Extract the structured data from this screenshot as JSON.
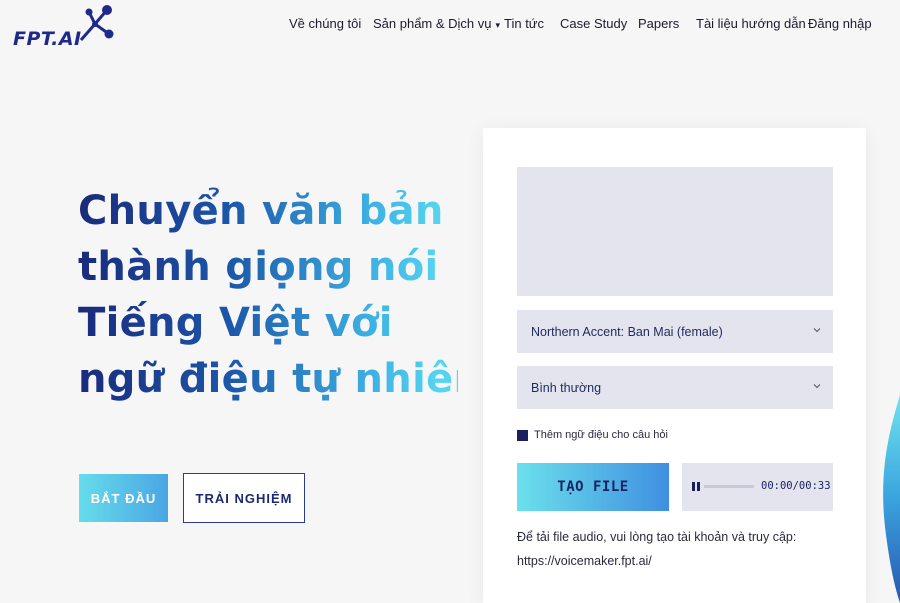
{
  "header": {
    "logo_text": "FPT.AI",
    "nav": [
      {
        "label": "Về chúng tôi"
      },
      {
        "label": "Sản phẩm & Dịch vụ",
        "has_dropdown": true
      },
      {
        "label": "Tin tức"
      },
      {
        "label": "Case Study"
      },
      {
        "label": "Papers"
      },
      {
        "label": "Tài liệu hướng dẫn"
      },
      {
        "label": "Đăng nhập"
      }
    ]
  },
  "hero": {
    "title_lines": [
      "Chuyển văn bản",
      "thành giọng nói",
      "Tiếng Việt với",
      "ngữ điệu tự nhiên"
    ],
    "start_button": "BẮT ĐẦU",
    "try_button": "TRẢI NGHIỆM"
  },
  "tts_card": {
    "text_input_value": "",
    "voice_selected": "Northern Accent: Ban Mai (female)",
    "speed_selected": "Bình thường",
    "question_intonation_label": "Thêm ngữ điệu cho câu hỏi",
    "create_button": "TẠO FILE",
    "player": {
      "time": "00:00/00:33",
      "progress": 0.0
    },
    "note_text": "Để tải file audio, vui lòng tạo tài khoản và truy cập:",
    "note_url": "https://voicemaker.fpt.ai/"
  },
  "colors": {
    "brand_dark": "#1a2a7c",
    "brand_light": "#56d4ef",
    "field_bg": "#e4e4ef"
  },
  "icons": {
    "logo": "fpt-ai-logo",
    "select_arrow": "chevron-down-icon",
    "player_control": "pause-icon"
  }
}
